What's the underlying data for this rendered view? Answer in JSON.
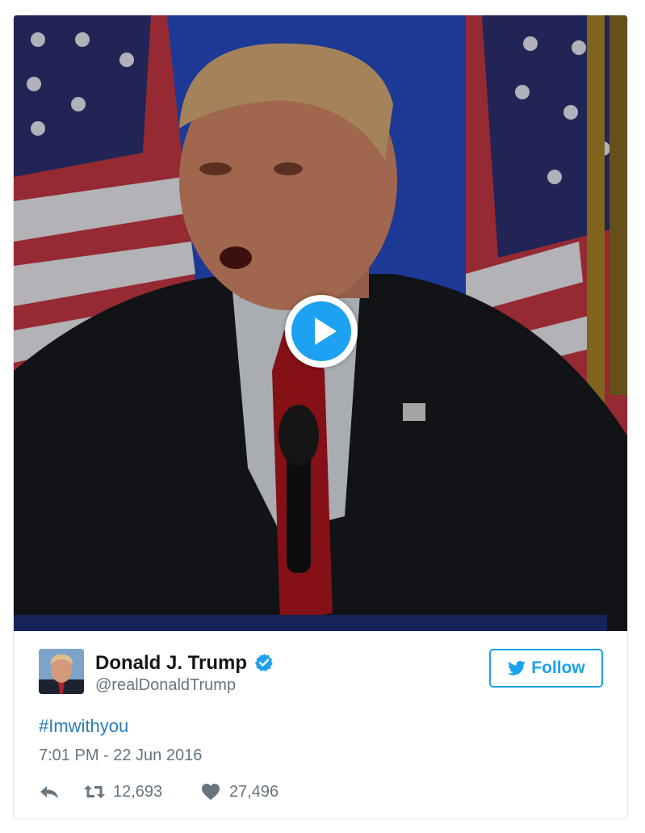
{
  "video": {
    "play_label": "Play video"
  },
  "tweet": {
    "author_name": "Donald J. Trump",
    "author_handle": "@realDonaldTrump",
    "verified_icon": "verified-badge-icon",
    "follow_label": "Follow",
    "text": "#Imwithyou",
    "timestamp": "7:01 PM - 22 Jun 2016",
    "retweets": "12,693",
    "likes": "27,496"
  },
  "colors": {
    "accent": "#1da1f2",
    "link": "#2b7bb9",
    "muted": "#66757f",
    "border": "#e1e8ed"
  }
}
